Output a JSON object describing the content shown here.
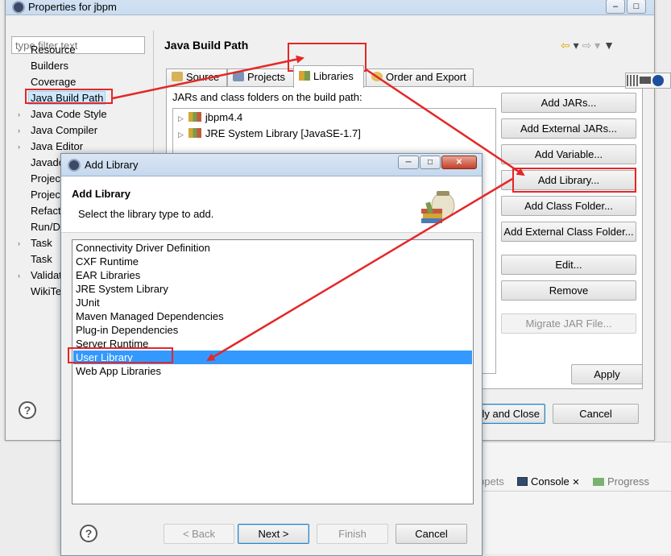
{
  "props_window": {
    "title": "Properties for jbpm",
    "filter_placeholder": "type filter text",
    "tree_items": [
      {
        "label": "Resource",
        "twisty": "›"
      },
      {
        "label": "Builders",
        "twisty": ""
      },
      {
        "label": "Coverage",
        "twisty": ""
      },
      {
        "label": "Java Build Path",
        "twisty": "",
        "selected": true
      },
      {
        "label": "Java Code Style",
        "twisty": "›"
      },
      {
        "label": "Java Compiler",
        "twisty": "›"
      },
      {
        "label": "Java Editor",
        "twisty": "›"
      },
      {
        "label": "Javadoc",
        "twisty": ""
      },
      {
        "label": "Project",
        "twisty": ""
      },
      {
        "label": "Project",
        "twisty": ""
      },
      {
        "label": "Refactoring",
        "twisty": ""
      },
      {
        "label": "Run/Debug",
        "twisty": ""
      },
      {
        "label": "Task",
        "twisty": "›"
      },
      {
        "label": "Task",
        "twisty": ""
      },
      {
        "label": "Validation",
        "twisty": "›"
      },
      {
        "label": "WikiText",
        "twisty": ""
      }
    ],
    "page_title": "Java Build Path",
    "tabs": [
      "Source",
      "Projects",
      "Libraries",
      "Order and Export"
    ],
    "active_tab": "Libraries",
    "jars_label": "JARs and class folders on the build path:",
    "libraries": [
      {
        "label": "jbpm4.4"
      },
      {
        "label": "JRE System Library [JavaSE-1.7]"
      }
    ],
    "side_buttons": {
      "add_jars": "Add JARs...",
      "add_external_jars": "Add External JARs...",
      "add_variable": "Add Variable...",
      "add_library": "Add Library...",
      "add_class_folder": "Add Class Folder...",
      "add_external_class_folder": "Add External Class Folder...",
      "edit": "Edit...",
      "remove": "Remove",
      "migrate_jar": "Migrate JAR File..."
    },
    "apply": "Apply",
    "apply_and_close": "Apply and Close",
    "cancel": "Cancel"
  },
  "background": {
    "bottom_tabs": [
      "ppets",
      "Console",
      "Progress"
    ]
  },
  "add_library_dialog": {
    "title": "Add Library",
    "header_title": "Add Library",
    "header_message": "Select the library type to add.",
    "library_types": [
      "Connectivity Driver Definition",
      "CXF Runtime",
      "EAR Libraries",
      "JRE System Library",
      "JUnit",
      "Maven Managed Dependencies",
      "Plug-in Dependencies",
      "Server Runtime",
      "User Library",
      "Web App Libraries"
    ],
    "selected_type": "User Library",
    "buttons": {
      "back": "< Back",
      "next": "Next >",
      "finish": "Finish",
      "cancel": "Cancel"
    }
  },
  "colors": {
    "annotation_red": "#e42727",
    "selection_blue": "#3399ff"
  }
}
